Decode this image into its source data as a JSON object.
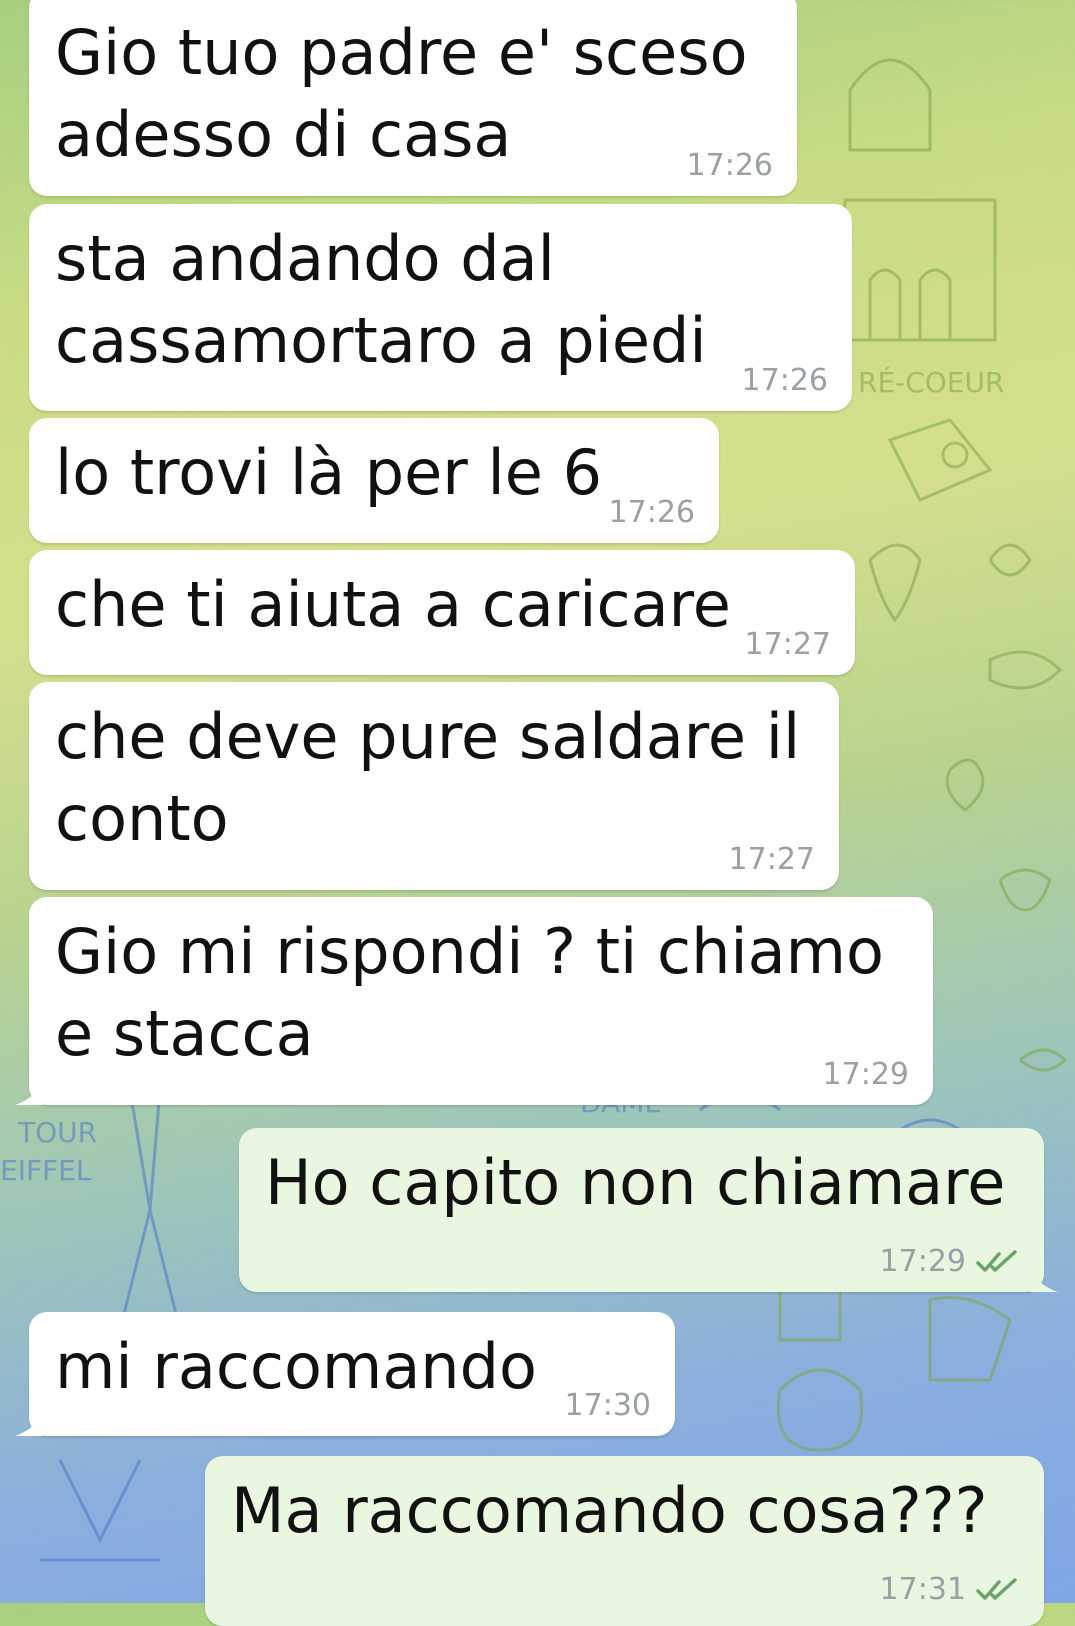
{
  "messages": [
    {
      "direction": "incoming",
      "text": "Gio tuo padre e' sceso\nadesso di casa",
      "time": "17:26"
    },
    {
      "direction": "incoming",
      "text": "sta andando dal\ncassamortaro a piedi",
      "time": "17:26"
    },
    {
      "direction": "incoming",
      "text": "lo trovi là per le 6",
      "time": "17:26"
    },
    {
      "direction": "incoming",
      "text": "che ti aiuta a caricare",
      "time": "17:27"
    },
    {
      "direction": "incoming",
      "text": "che deve pure saldare il\nconto",
      "time": "17:27"
    },
    {
      "direction": "incoming",
      "text": "Gio mi rispondi ? ti chiamo\ne stacca",
      "time": "17:29"
    },
    {
      "direction": "outgoing",
      "text": "Ho capito non chiamare",
      "time": "17:29",
      "status": "read"
    },
    {
      "direction": "incoming",
      "text": "mi raccomando",
      "time": "17:30"
    },
    {
      "direction": "outgoing",
      "text": "Ma raccomando cosa???",
      "time": "17:31",
      "status": "read"
    }
  ],
  "wallpaper": {
    "labels": [
      "TOUR",
      "EIFFEL",
      "RÉ-COEUR",
      "DAME"
    ]
  },
  "colors": {
    "incoming_bubble": "#ffffff",
    "outgoing_bubble": "#e9f7e0",
    "read_check": "#6aa567",
    "timestamp": "#9aa0a4"
  }
}
